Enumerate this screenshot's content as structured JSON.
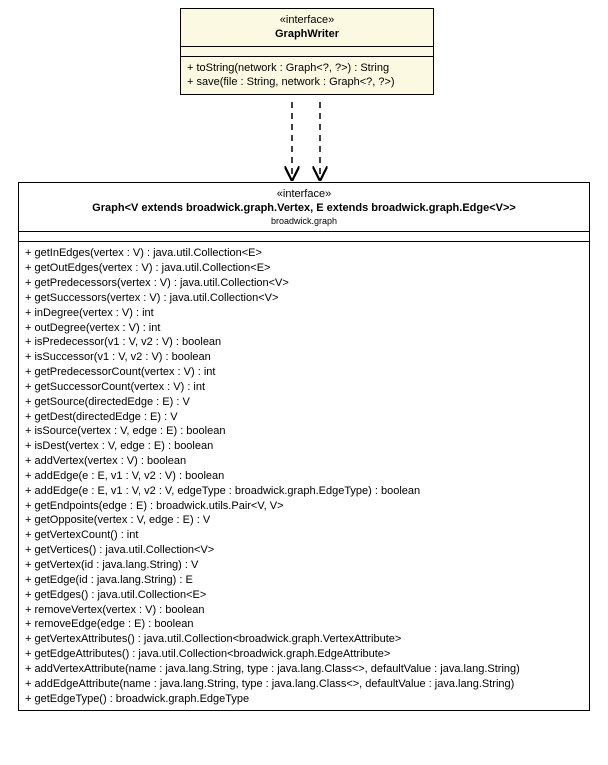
{
  "top": {
    "stereo": "«interface»",
    "name": "GraphWriter",
    "ops": [
      "+ toString(network : Graph<?, ?>) : String",
      "+ save(file : String, network : Graph<?, ?>)"
    ]
  },
  "bottom": {
    "stereo": "«interface»",
    "name": "Graph<V extends broadwick.graph.Vertex, E extends broadwick.graph.Edge<V>>",
    "pkg": "broadwick.graph",
    "ops": [
      "+ getInEdges(vertex : V) : java.util.Collection<E>",
      "+ getOutEdges(vertex : V) : java.util.Collection<E>",
      "+ getPredecessors(vertex : V) : java.util.Collection<V>",
      "+ getSuccessors(vertex : V) : java.util.Collection<V>",
      "+ inDegree(vertex : V) : int",
      "+ outDegree(vertex : V) : int",
      "+ isPredecessor(v1 : V, v2 : V) : boolean",
      "+ isSuccessor(v1 : V, v2 : V) : boolean",
      "+ getPredecessorCount(vertex : V) : int",
      "+ getSuccessorCount(vertex : V) : int",
      "+ getSource(directedEdge : E) : V",
      "+ getDest(directedEdge : E) : V",
      "+ isSource(vertex : V, edge : E) : boolean",
      "+ isDest(vertex : V, edge : E) : boolean",
      "+ addVertex(vertex : V) : boolean",
      "+ addEdge(e : E, v1 : V, v2 : V) : boolean",
      "+ addEdge(e : E, v1 : V, v2 : V, edgeType : broadwick.graph.EdgeType) : boolean",
      "+ getEndpoints(edge : E) : broadwick.utils.Pair<V, V>",
      "+ getOpposite(vertex : V, edge : E) : V",
      "+ getVertexCount() : int",
      "+ getVertices() : java.util.Collection<V>",
      "+ getVertex(id : java.lang.String) : V",
      "+ getEdge(id : java.lang.String) : E",
      "+ getEdges() : java.util.Collection<E>",
      "+ removeVertex(vertex : V) : boolean",
      "+ removeEdge(edge : E) : boolean",
      "+ getVertexAttributes() : java.util.Collection<broadwick.graph.VertexAttribute>",
      "+ getEdgeAttributes() : java.util.Collection<broadwick.graph.EdgeAttribute>",
      "+ addVertexAttribute(name : java.lang.String, type : java.lang.Class<>, defaultValue : java.lang.String)",
      "+ addEdgeAttribute(name : java.lang.String, type : java.lang.Class<>, defaultValue : java.lang.String)",
      "+ getEdgeType() : broadwick.graph.EdgeType"
    ]
  }
}
